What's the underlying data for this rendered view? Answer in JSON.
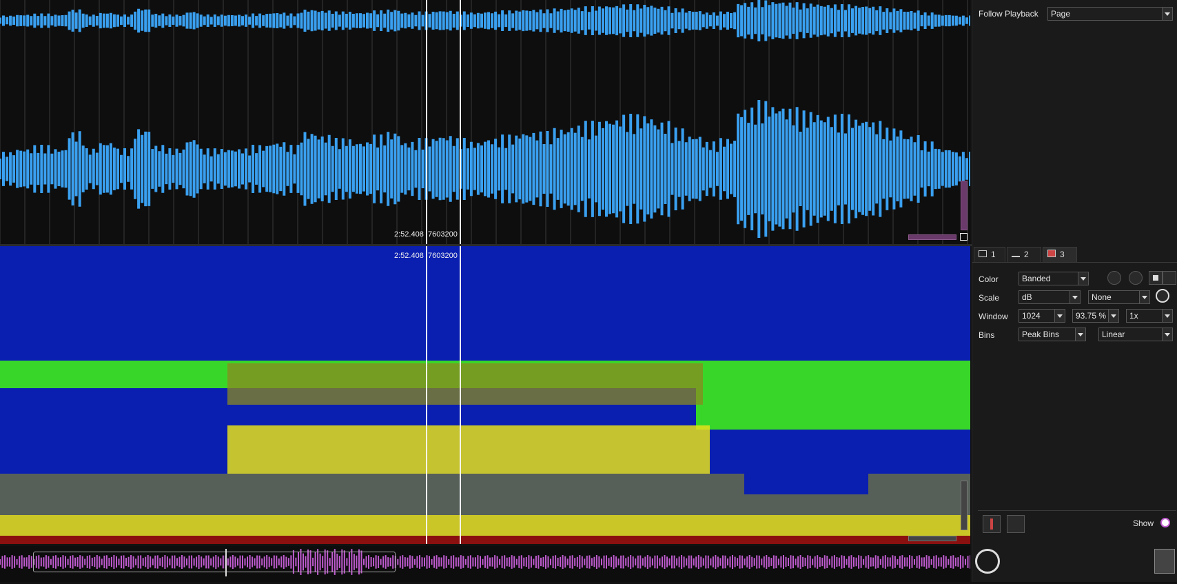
{
  "waveform": {
    "timecode": "2:52.408",
    "sample": "7603200",
    "channels": 2,
    "color": "#3aa0f0",
    "levels": [
      0.25,
      0.3,
      0.35,
      0.3,
      0.55,
      0.3,
      0.4,
      0.3,
      0.6,
      0.35,
      0.3,
      0.45,
      0.3,
      0.3,
      0.3,
      0.35,
      0.4,
      0.35,
      0.55,
      0.5,
      0.45,
      0.4,
      0.5,
      0.55,
      0.4,
      0.45,
      0.5,
      0.45,
      0.4,
      0.45,
      0.5,
      0.55,
      0.55,
      0.6,
      0.65,
      0.7,
      0.75,
      0.8,
      0.8,
      0.7,
      0.6,
      0.5,
      0.4,
      0.45,
      0.9,
      1.0,
      0.95,
      0.9,
      0.85,
      0.8,
      0.8,
      0.75,
      0.7,
      0.6,
      0.5,
      0.4,
      0.3,
      0.25
    ]
  },
  "spectrogram": {
    "timecode": "2:52.408",
    "sample": "7603200",
    "colors": {
      "blue": "#0a1fb0",
      "green": "#39d62a",
      "yellow": "#e8e01a",
      "olive": "#8a8a20",
      "red": "#8a1010"
    }
  },
  "overview": {
    "color": "#c05cd0"
  },
  "panel": {
    "follow_playback_label": "Follow Playback",
    "follow_playback_value": "Page",
    "tabs": [
      {
        "label": "1"
      },
      {
        "label": "2"
      },
      {
        "label": "3"
      }
    ],
    "color_label": "Color",
    "color_value": "Banded",
    "scale_label": "Scale",
    "scale_value": "dB",
    "scale_value2": "None",
    "window_label": "Window",
    "window_value": "1024",
    "window_overlap": "93.75 %",
    "window_zoom": "1x",
    "bins_label": "Bins",
    "bins_value": "Peak Bins",
    "bins_value2": "Linear",
    "show_label": "Show"
  }
}
